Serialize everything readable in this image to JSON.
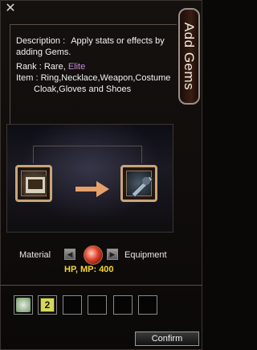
{
  "window": {
    "tab_label": "Add Gems",
    "close_glyph": "✕"
  },
  "description": {
    "label": "Description :",
    "text": "Apply stats or effects by adding Gems.",
    "rank_label": "Rank :",
    "rank_rare": "Rare,",
    "rank_elite": "Elite",
    "item_label": "Item :",
    "item_text_line1": "Ring,Necklace,Weapon,Costume",
    "item_text_line2": "Cloak,Gloves and Shoes"
  },
  "panel": {
    "material_label": "Material",
    "equipment_label": "Equipment",
    "stat_text": "HP, MP: 400",
    "prev_glyph": "◀",
    "next_glyph": "▶"
  },
  "bottom_slots": {
    "slot2_count": "2"
  },
  "footer": {
    "confirm_label": "Confirm"
  },
  "colors": {
    "elite": "#c98ad8",
    "stat_text": "#f5d431",
    "slot_border": "#c9a57a"
  },
  "icons": [
    "close-icon",
    "material-scroll-icon",
    "arrow-right-icon",
    "equipment-weapon-icon",
    "gem-icon",
    "gem-item-icon"
  ]
}
